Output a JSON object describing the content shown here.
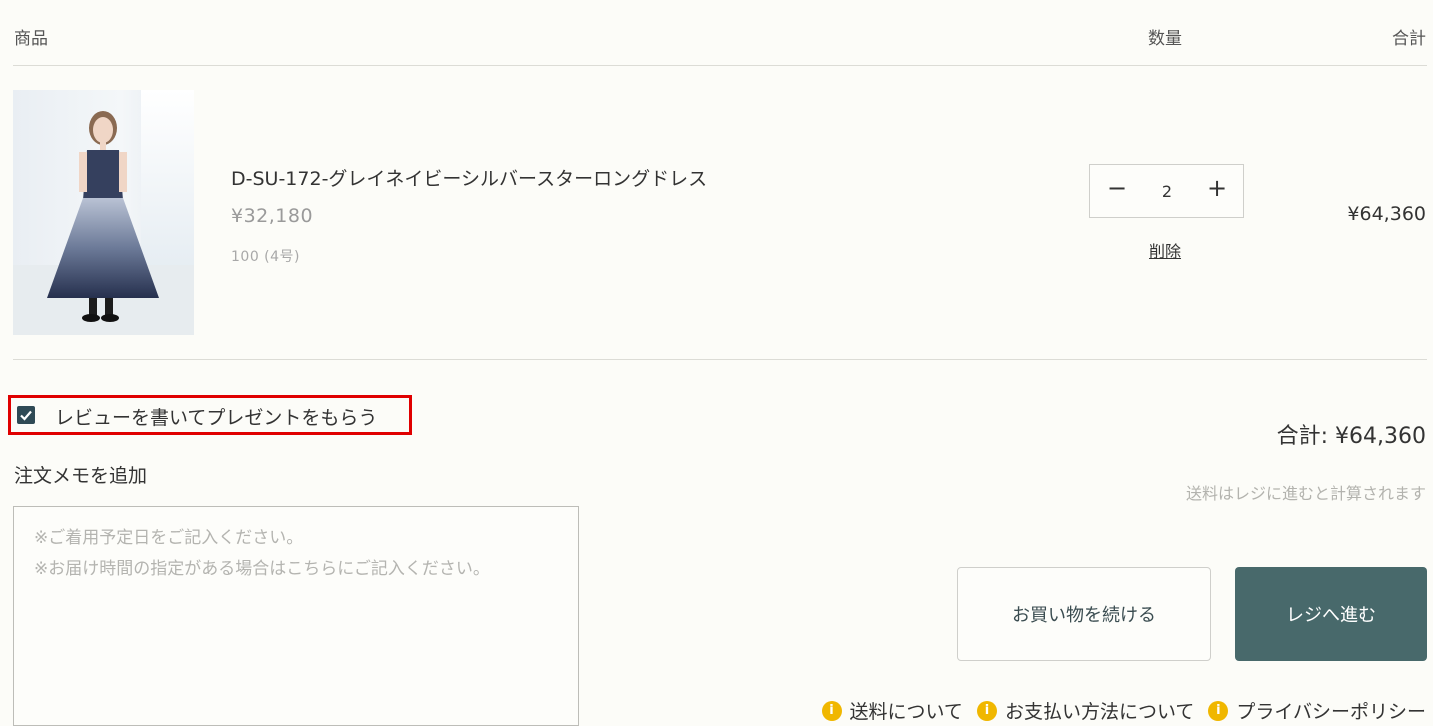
{
  "table_header": {
    "product": "商品",
    "quantity": "数量",
    "total": "合計"
  },
  "item": {
    "name": "D-SU-172-グレイネイビーシルバースターロングドレス",
    "price": "¥32,180",
    "variant": "100 (4号)",
    "quantity": "2",
    "minus": "−",
    "plus": "+",
    "remove_label": "削除",
    "line_total": "¥64,360"
  },
  "review": {
    "label": "レビューを書いてプレゼントをもらう",
    "checked": true
  },
  "memo": {
    "label": "注文メモを追加",
    "placeholder": "※ご着用予定日をご記入ください。\n※お届け時間の指定がある場合はこちらにご記入ください。"
  },
  "summary": {
    "total": "合計: ¥64,360",
    "shipping_note": "送料はレジに進むと計算されます"
  },
  "buttons": {
    "continue_shopping": "お買い物を続ける",
    "checkout": "レジへ進む"
  },
  "footer_links": [
    {
      "label": "送料について",
      "icon": "info-icon"
    },
    {
      "label": "お支払い方法について",
      "icon": "info-icon"
    },
    {
      "label": "プライバシーポリシー",
      "icon": "info-icon"
    }
  ],
  "colors": {
    "background": "#fcfcf8",
    "checkout_button": "#48696b",
    "highlight_border": "#e00000",
    "checkbox": "#2f4a55",
    "info_icon": "#f0b700"
  }
}
